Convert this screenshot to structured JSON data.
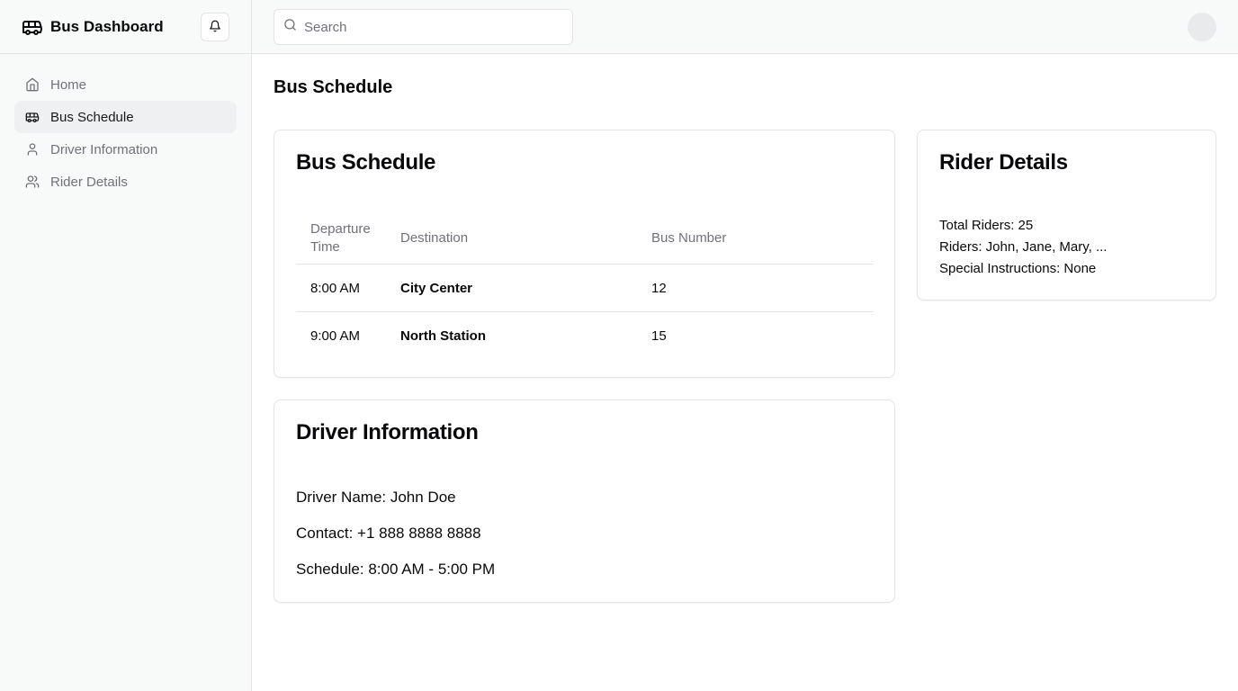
{
  "brand": {
    "title": "Bus Dashboard",
    "icon": "bus-icon"
  },
  "header": {
    "search_placeholder": "Search",
    "notification_icon": "bell-icon"
  },
  "sidebar": {
    "items": [
      {
        "label": "Home",
        "icon": "home-icon",
        "active": false
      },
      {
        "label": "Bus Schedule",
        "icon": "bus-icon",
        "active": true
      },
      {
        "label": "Driver Information",
        "icon": "user-icon",
        "active": false
      },
      {
        "label": "Rider Details",
        "icon": "users-icon",
        "active": false
      }
    ]
  },
  "page": {
    "title": "Bus Schedule"
  },
  "schedule": {
    "title": "Bus Schedule",
    "columns": [
      "Departure Time",
      "Destination",
      "Bus Number"
    ],
    "rows": [
      {
        "time": "8:00 AM",
        "destination": "City Center",
        "bus": "12"
      },
      {
        "time": "9:00 AM",
        "destination": "North Station",
        "bus": "15"
      }
    ]
  },
  "driver": {
    "title": "Driver Information",
    "name": "Driver Name: John Doe",
    "contact": "Contact: +1 888 8888 8888",
    "schedule": "Schedule: 8:00 AM - 5:00 PM"
  },
  "riders": {
    "title": "Rider Details",
    "total": "Total Riders: 25",
    "names": "Riders: John, Jane, Mary, ...",
    "instructions": "Special Instructions: None"
  },
  "colors": {
    "accent_text": "#09090b",
    "muted_text": "#71717a",
    "border": "#e4e4e7",
    "sidebar_bg": "#f8f9f9",
    "active_bg": "#eef0f2"
  }
}
